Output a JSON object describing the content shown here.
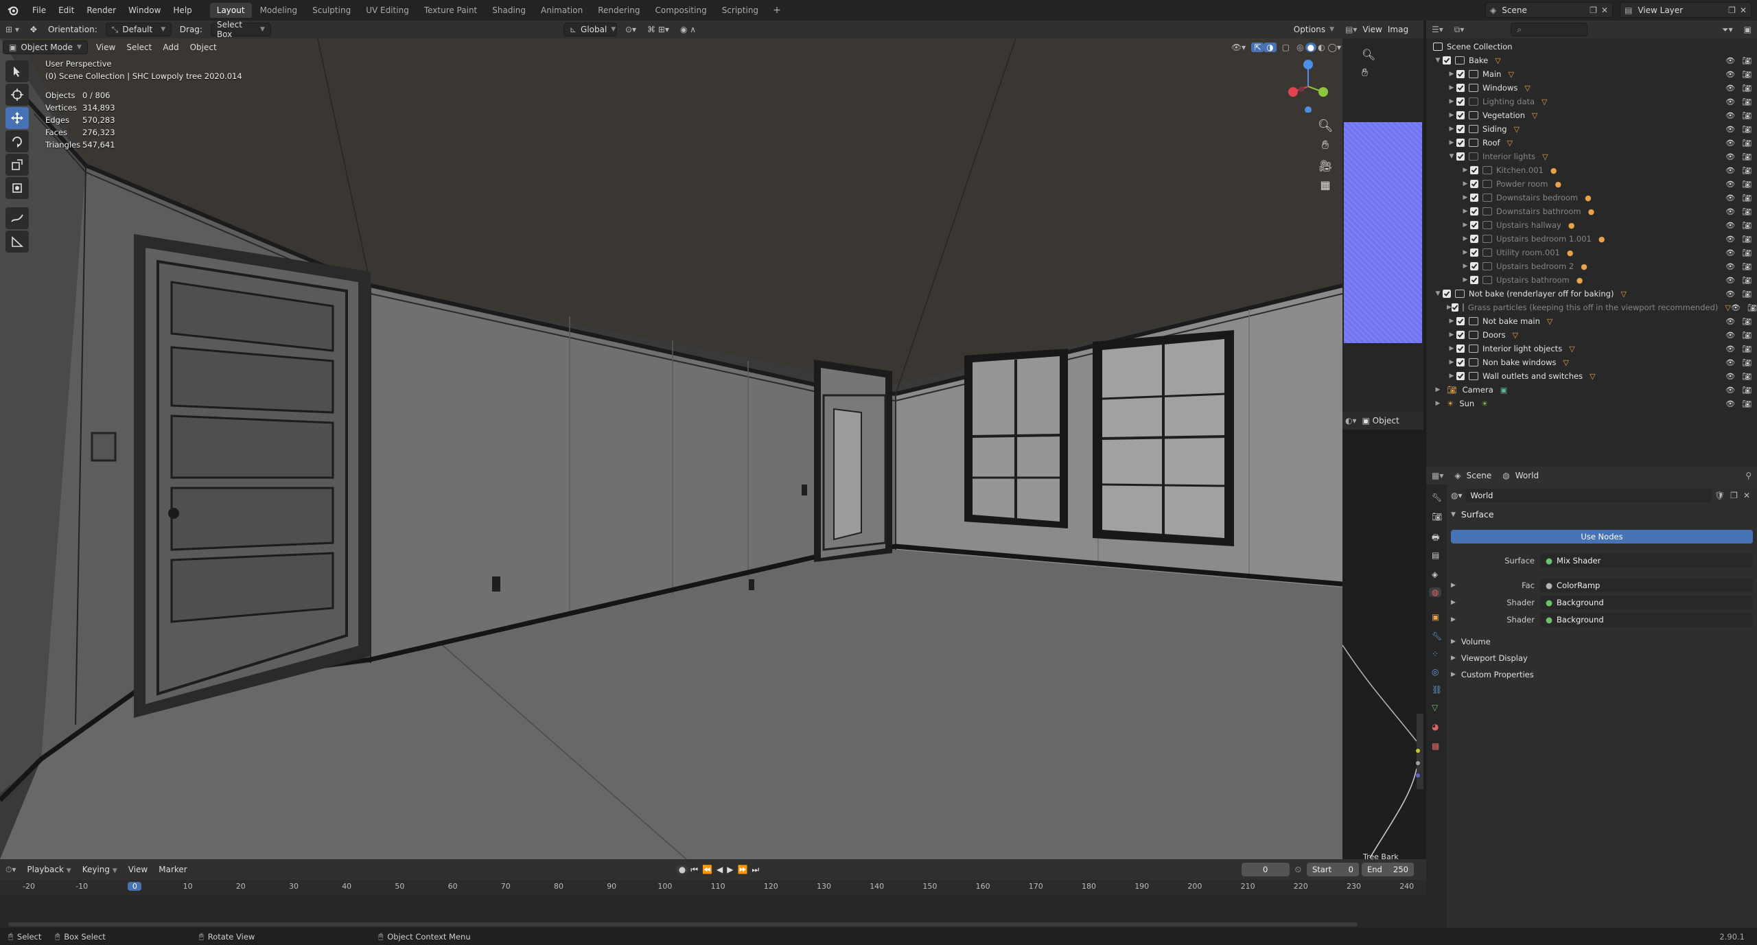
{
  "topbar": {
    "menus": [
      "File",
      "Edit",
      "Render",
      "Window",
      "Help"
    ],
    "workspaces": [
      "Layout",
      "Modeling",
      "Sculpting",
      "UV Editing",
      "Texture Paint",
      "Shading",
      "Animation",
      "Rendering",
      "Compositing",
      "Scripting"
    ],
    "active_workspace": "Layout",
    "scene": "Scene",
    "view_layer": "View Layer"
  },
  "viewport_header": {
    "orientation_label": "Orientation:",
    "orientation_value": "Default",
    "drag_label": "Drag:",
    "drag_value": "Select Box",
    "transform": "Global",
    "options": "Options",
    "mode": "Object Mode",
    "menus": [
      "View",
      "Select",
      "Add",
      "Object"
    ]
  },
  "viewport": {
    "perspective": "User Perspective",
    "collection": "(0) Scene Collection | SHC Lowpoly tree 2020.014",
    "stats": [
      {
        "label": "Objects",
        "value": "0 / 806"
      },
      {
        "label": "Vertices",
        "value": "314,893"
      },
      {
        "label": "Edges",
        "value": "570,283"
      },
      {
        "label": "Faces",
        "value": "276,323"
      },
      {
        "label": "Triangles",
        "value": "547,641"
      }
    ]
  },
  "image_editor": {
    "menus": [
      "View",
      "Imag"
    ],
    "object_label": "Object",
    "node_label": "Tree Bark"
  },
  "outliner": {
    "root": "Scene Collection",
    "rows": [
      {
        "label": "Bake",
        "level": 0,
        "dim": false,
        "open": true
      },
      {
        "label": "Main",
        "level": 1,
        "dim": false
      },
      {
        "label": "Windows",
        "level": 1,
        "dim": false
      },
      {
        "label": "Lighting data",
        "level": 1,
        "dim": true
      },
      {
        "label": "Vegetation",
        "level": 1,
        "dim": false
      },
      {
        "label": "Siding",
        "level": 1,
        "dim": false
      },
      {
        "label": "Roof",
        "level": 1,
        "dim": false
      },
      {
        "label": "Interior lights",
        "level": 1,
        "dim": true,
        "open": true
      },
      {
        "label": "Kitchen.001",
        "level": 2,
        "dim": true
      },
      {
        "label": "Powder room",
        "level": 2,
        "dim": true
      },
      {
        "label": "Downstairs bedroom",
        "level": 2,
        "dim": true
      },
      {
        "label": "Downstairs bathroom",
        "level": 2,
        "dim": true
      },
      {
        "label": "Upstairs hallway",
        "level": 2,
        "dim": true
      },
      {
        "label": "Upstairs bedroom 1.001",
        "level": 2,
        "dim": true
      },
      {
        "label": "Utility room.001",
        "level": 2,
        "dim": true
      },
      {
        "label": "Upstairs bedroom 2",
        "level": 2,
        "dim": true
      },
      {
        "label": "Upstairs bathroom",
        "level": 2,
        "dim": true
      },
      {
        "label": "Not bake (renderlayer off for baking)",
        "level": 0,
        "dim": false,
        "open": true
      },
      {
        "label": "Grass particles (keeping this off in the viewport recommended)",
        "level": 1,
        "dim": true
      },
      {
        "label": "Not bake main",
        "level": 1,
        "dim": false
      },
      {
        "label": "Doors",
        "level": 1,
        "dim": false
      },
      {
        "label": "Interior light objects",
        "level": 1,
        "dim": false
      },
      {
        "label": "Non bake windows",
        "level": 1,
        "dim": false
      },
      {
        "label": "Wall outlets and switches",
        "level": 1,
        "dim": false
      },
      {
        "label": "Camera",
        "level": 0,
        "dim": false,
        "type": "camera"
      },
      {
        "label": "Sun",
        "level": 0,
        "dim": false,
        "type": "light"
      }
    ]
  },
  "properties": {
    "breadcrumb": [
      "Scene",
      "World"
    ],
    "world_name": "World",
    "surface_section": "Surface",
    "use_nodes": "Use Nodes",
    "rows": [
      {
        "label": "Surface",
        "value": "Mix Shader"
      },
      {
        "label": "Fac",
        "value": "ColorRamp"
      },
      {
        "label": "Shader",
        "value": "Background"
      },
      {
        "label": "Shader",
        "value": "Background"
      }
    ],
    "sections": [
      "Volume",
      "Viewport Display",
      "Custom Properties"
    ]
  },
  "timeline": {
    "menus": [
      "Playback",
      "Keying",
      "View",
      "Marker"
    ],
    "current_frame": "0",
    "start_label": "Start",
    "start": "0",
    "end_label": "End",
    "end": "250",
    "ticks": [
      "-20",
      "-10",
      "0",
      "10",
      "20",
      "30",
      "40",
      "50",
      "60",
      "70",
      "80",
      "90",
      "100",
      "110",
      "120",
      "130",
      "140",
      "150",
      "160",
      "170",
      "180",
      "190",
      "200",
      "210",
      "220",
      "230",
      "240"
    ]
  },
  "statusbar": {
    "select": "Select",
    "box_select": "Box Select",
    "rotate": "Rotate View",
    "context": "Object Context Menu",
    "version": "2.90.1"
  },
  "colors": {
    "accent": "#4772b3",
    "checker": "#e7e7e7",
    "x_axis": "#e2434f",
    "y_axis": "#8cc63f",
    "z_axis": "#4d8fe3"
  }
}
